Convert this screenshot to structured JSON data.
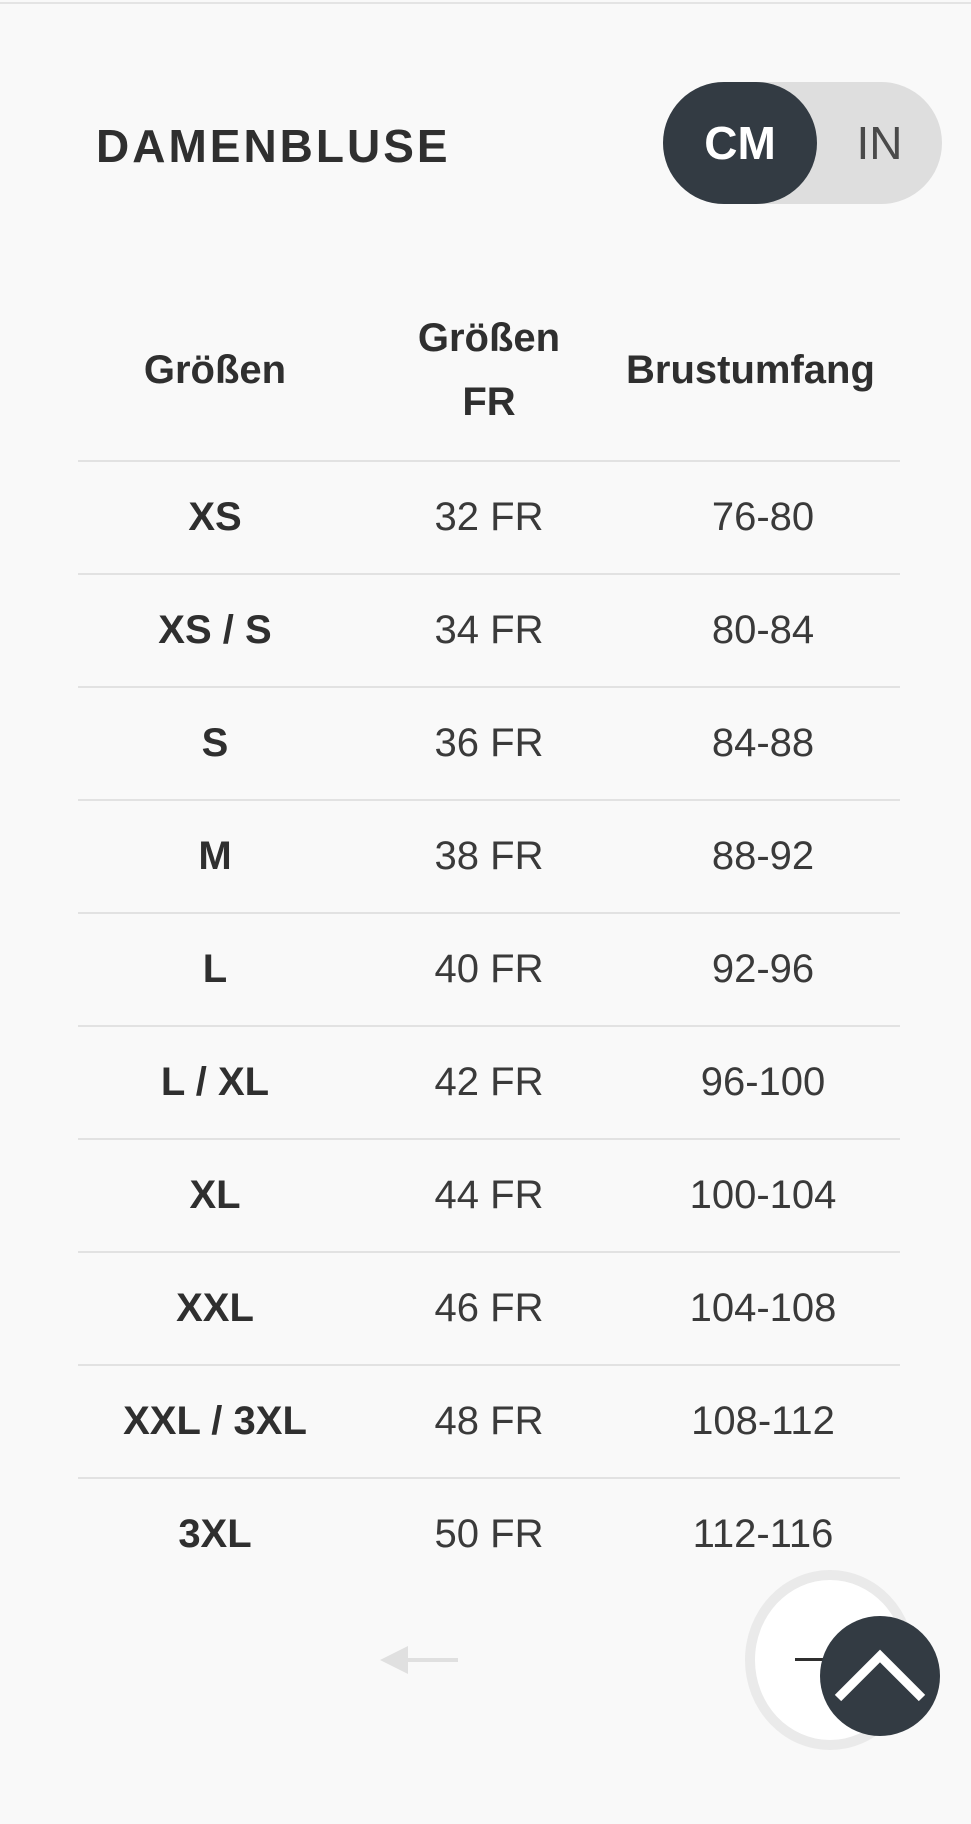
{
  "title": "DAMENBLUSE",
  "unit_toggle": {
    "active": "CM",
    "inactive": "IN"
  },
  "table": {
    "headers": {
      "size": "Größen",
      "size_fr_line1": "Größen",
      "size_fr_line2": "FR",
      "bust": "Brustumfang"
    },
    "rows": [
      {
        "size": "XS",
        "fr": "32 FR",
        "bust": "76-80"
      },
      {
        "size": "XS / S",
        "fr": "34 FR",
        "bust": "80-84"
      },
      {
        "size": "S",
        "fr": "36 FR",
        "bust": "84-88"
      },
      {
        "size": "M",
        "fr": "38 FR",
        "bust": "88-92"
      },
      {
        "size": "L",
        "fr": "40 FR",
        "bust": "92-96"
      },
      {
        "size": "L / XL",
        "fr": "42 FR",
        "bust": "96-100"
      },
      {
        "size": "XL",
        "fr": "44 FR",
        "bust": "100-104"
      },
      {
        "size": "XXL",
        "fr": "46 FR",
        "bust": "104-108"
      },
      {
        "size": "XXL / 3XL",
        "fr": "48 FR",
        "bust": "108-112"
      },
      {
        "size": "3XL",
        "fr": "50 FR",
        "bust": "112-116"
      }
    ]
  },
  "icons": {
    "prev": "arrow-left-icon",
    "next": "arrow-right-icon",
    "scroll_top": "chevron-up-icon"
  },
  "colors": {
    "accent": "#333b43",
    "toggle_bg": "#dedede",
    "background": "#f9f9f9"
  }
}
